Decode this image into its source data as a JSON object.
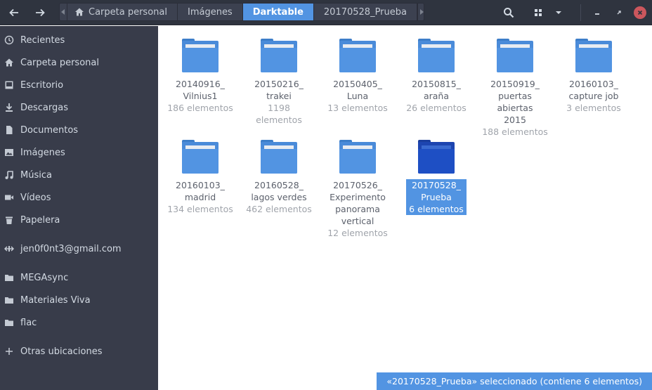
{
  "header": {
    "back_icon": "arrow-left-icon",
    "forward_icon": "arrow-right-icon",
    "path": [
      {
        "label": "Carpeta personal",
        "icon": "home-icon"
      },
      {
        "label": "Imágenes"
      },
      {
        "label": "Darktable",
        "active": true
      },
      {
        "label": "20170528_Prueba"
      }
    ],
    "search_icon": "search-icon",
    "view_icon": "grid-view-icon"
  },
  "sidebar": {
    "items": [
      {
        "label": "Recientes",
        "icon": "clock-icon"
      },
      {
        "label": "Carpeta personal",
        "icon": "home-icon"
      },
      {
        "label": "Escritorio",
        "icon": "desktop-icon"
      },
      {
        "label": "Descargas",
        "icon": "download-icon"
      },
      {
        "label": "Documentos",
        "icon": "document-icon"
      },
      {
        "label": "Imágenes",
        "icon": "image-icon"
      },
      {
        "label": "Música",
        "icon": "music-icon"
      },
      {
        "label": "Vídeos",
        "icon": "video-icon"
      },
      {
        "label": "Papelera",
        "icon": "trash-icon"
      },
      {
        "label": "jen0f0nt3@gmail.com",
        "icon": "network-icon"
      },
      {
        "label": "MEGAsync",
        "icon": "folder-icon"
      },
      {
        "label": "Materiales Viva",
        "icon": "folder-icon"
      },
      {
        "label": "flac",
        "icon": "folder-icon"
      },
      {
        "label": "Otras ubicaciones",
        "icon": "plus-icon"
      }
    ]
  },
  "folders": [
    {
      "name": [
        "20140916_",
        "Vilnius1"
      ],
      "count": "186 elementos"
    },
    {
      "name": [
        "20150216_",
        "trakei"
      ],
      "count": "1198 elementos"
    },
    {
      "name": [
        "20150405_",
        "Luna"
      ],
      "count": "13 elementos"
    },
    {
      "name": [
        "20150815_",
        "araña"
      ],
      "count": "26 elementos"
    },
    {
      "name": [
        "20150919_",
        "puertas abiertas",
        "2015"
      ],
      "count": "188 elementos"
    },
    {
      "name": [
        "20160103_",
        "capture job"
      ],
      "count": "3 elementos"
    },
    {
      "name": [
        "20160103_",
        "madrid"
      ],
      "count": "134 elementos"
    },
    {
      "name": [
        "20160528_",
        "lagos verdes"
      ],
      "count": "462 elementos"
    },
    {
      "name": [
        "20170526_",
        "Experimento",
        "panorama",
        "vertical"
      ],
      "count": "12 elementos"
    },
    {
      "name": [
        "20170528_",
        "Prueba"
      ],
      "count": "6 elementos",
      "selected": true
    }
  ],
  "status_text": "«20170528_Prueba» seleccionado  (contiene 6 elementos)",
  "colors": {
    "accent": "#5294e2",
    "sidebar": "#383c4a",
    "header": "#2f343f",
    "close": "#cc575d"
  }
}
